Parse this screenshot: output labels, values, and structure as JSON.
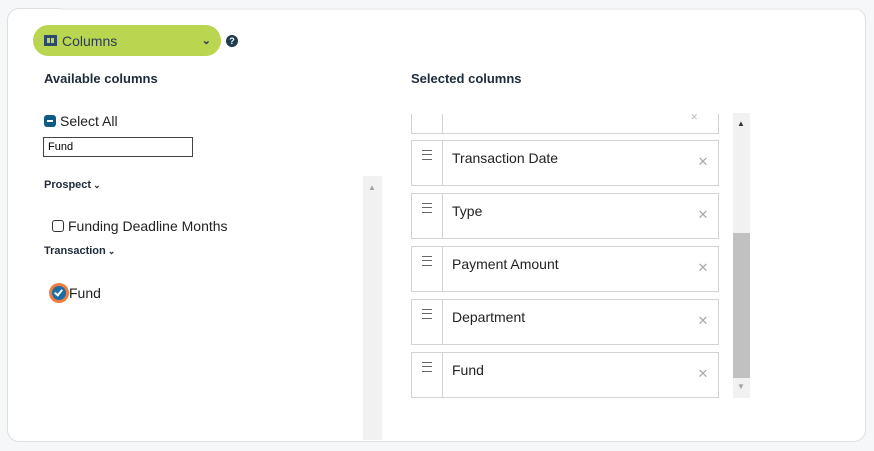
{
  "toolbar": {
    "columns_label": "Columns",
    "help_glyph": "?"
  },
  "available": {
    "heading": "Available columns",
    "select_all_label": "Select All",
    "search_value": "Fund",
    "groups": [
      {
        "title": "Prospect",
        "items": [
          {
            "label": "Funding Deadline Months",
            "checked": false
          }
        ]
      },
      {
        "title": "Transaction",
        "items": [
          {
            "label": "Fund",
            "checked": true
          }
        ]
      }
    ]
  },
  "selected": {
    "heading": "Selected columns",
    "items": [
      {
        "label": "Transaction Date"
      },
      {
        "label": "Type"
      },
      {
        "label": "Payment Amount"
      },
      {
        "label": "Department"
      },
      {
        "label": "Fund"
      }
    ],
    "remove_glyph": "✕"
  },
  "icons": {
    "columns": "columns-icon",
    "dropdown": "chevron-down-icon",
    "help": "question-circle-icon",
    "drag": "drag-handle-icon",
    "remove": "close-icon"
  },
  "colors": {
    "pill_bg": "#bad550",
    "accent_blue": "#1b6ea3",
    "focus_ring": "#ef7d3f"
  }
}
